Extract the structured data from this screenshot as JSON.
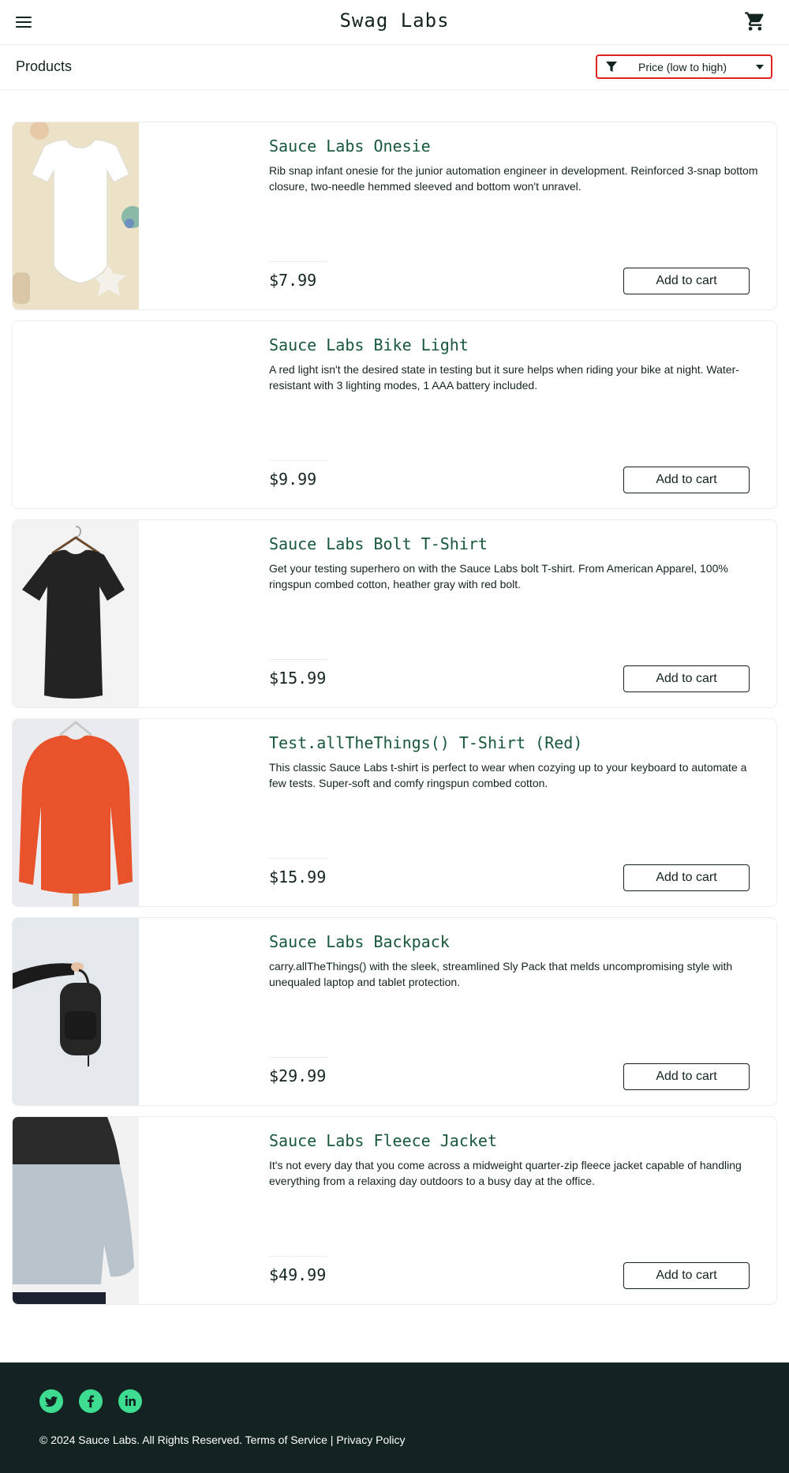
{
  "header": {
    "menu_icon": "hamburger-icon",
    "logo": "Swag Labs",
    "cart_icon": "shopping-cart-icon"
  },
  "subheader": {
    "title": "Products",
    "sort": {
      "icon": "filter-icon",
      "selected": "Price (low to high)"
    }
  },
  "products": [
    {
      "name": "Sauce Labs Onesie",
      "description": "Rib snap infant onesie for the junior automation engineer in development. Reinforced 3-snap bottom closure, two-needle hemmed sleeved and bottom won't unravel.",
      "price": "$7.99",
      "button": "Add to cart"
    },
    {
      "name": "Sauce Labs Bike Light",
      "description": "A red light isn't the desired state in testing but it sure helps when riding your bike at night. Water-resistant with 3 lighting modes, 1 AAA battery included.",
      "price": "$9.99",
      "button": "Add to cart"
    },
    {
      "name": "Sauce Labs Bolt T-Shirt",
      "description": "Get your testing superhero on with the Sauce Labs bolt T-shirt. From American Apparel, 100% ringspun combed cotton, heather gray with red bolt.",
      "price": "$15.99",
      "button": "Add to cart"
    },
    {
      "name": "Test.allTheThings() T-Shirt (Red)",
      "description": "This classic Sauce Labs t-shirt is perfect to wear when cozying up to your keyboard to automate a few tests. Super-soft and comfy ringspun combed cotton.",
      "price": "$15.99",
      "button": "Add to cart"
    },
    {
      "name": "Sauce Labs Backpack",
      "description": "carry.allTheThings() with the sleek, streamlined Sly Pack that melds uncompromising style with unequaled laptop and tablet protection.",
      "price": "$29.99",
      "button": "Add to cart"
    },
    {
      "name": "Sauce Labs Fleece Jacket",
      "description": "It's not every day that you come across a midweight quarter-zip fleece jacket capable of handling everything from a relaxing day outdoors to a busy day at the office.",
      "price": "$49.99",
      "button": "Add to cart"
    }
  ],
  "footer": {
    "social": [
      "twitter-icon",
      "facebook-icon",
      "linkedin-icon"
    ],
    "copyright": "© 2024 Sauce Labs. All Rights Reserved. Terms of Service | Privacy Policy"
  },
  "colors": {
    "accent_green": "#3ddc91",
    "title_green": "#18583a",
    "dark": "#132322",
    "sort_outline": "#e2231a"
  }
}
